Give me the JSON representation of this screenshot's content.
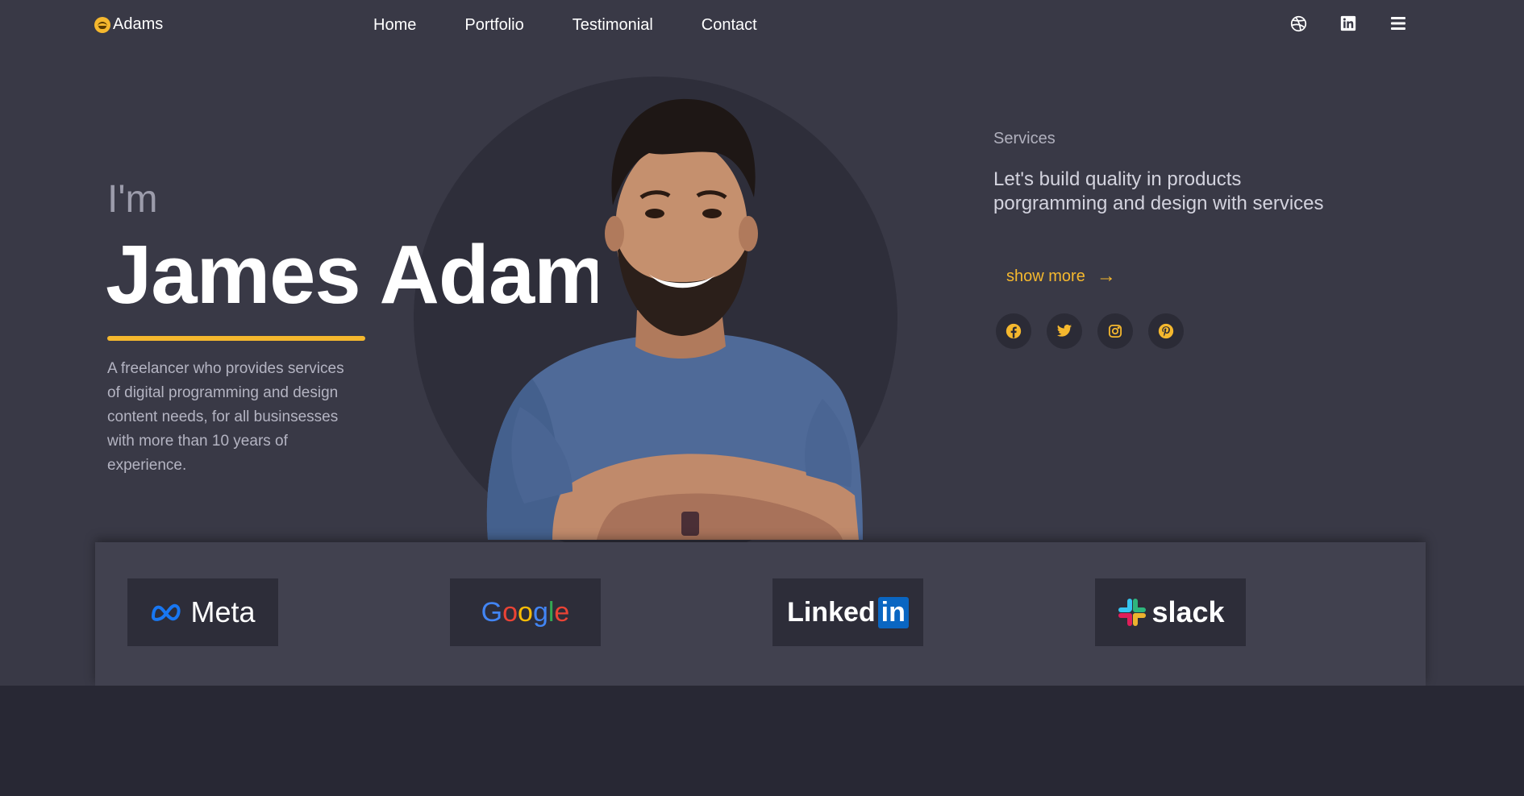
{
  "brand": {
    "logo_text": "Adams"
  },
  "nav": {
    "links": [
      "Home",
      "Portfolio",
      "Testimonial",
      "Contact"
    ],
    "icons": [
      "dribbble-icon",
      "linkedin-icon",
      "menu-icon"
    ]
  },
  "hero": {
    "greeting": "I'm",
    "name": "James Adams",
    "bio": "A freelancer who provides services of digital programming and design content needs, for all businsesses with more than 10 years of experience."
  },
  "services": {
    "label": "Services",
    "headline": "Let's build quality in products porgramming and design with services",
    "cta": "show more",
    "cta_arrow": "→",
    "socials": [
      "facebook-icon",
      "twitter-icon",
      "instagram-icon",
      "pinterest-icon"
    ]
  },
  "clients": {
    "logos": [
      "Meta",
      "Google",
      "Linked",
      "in",
      "slack"
    ]
  },
  "colors": {
    "background": "#393946",
    "accent": "#f5b82e",
    "strip": "#41414f",
    "dark": "#282834"
  }
}
